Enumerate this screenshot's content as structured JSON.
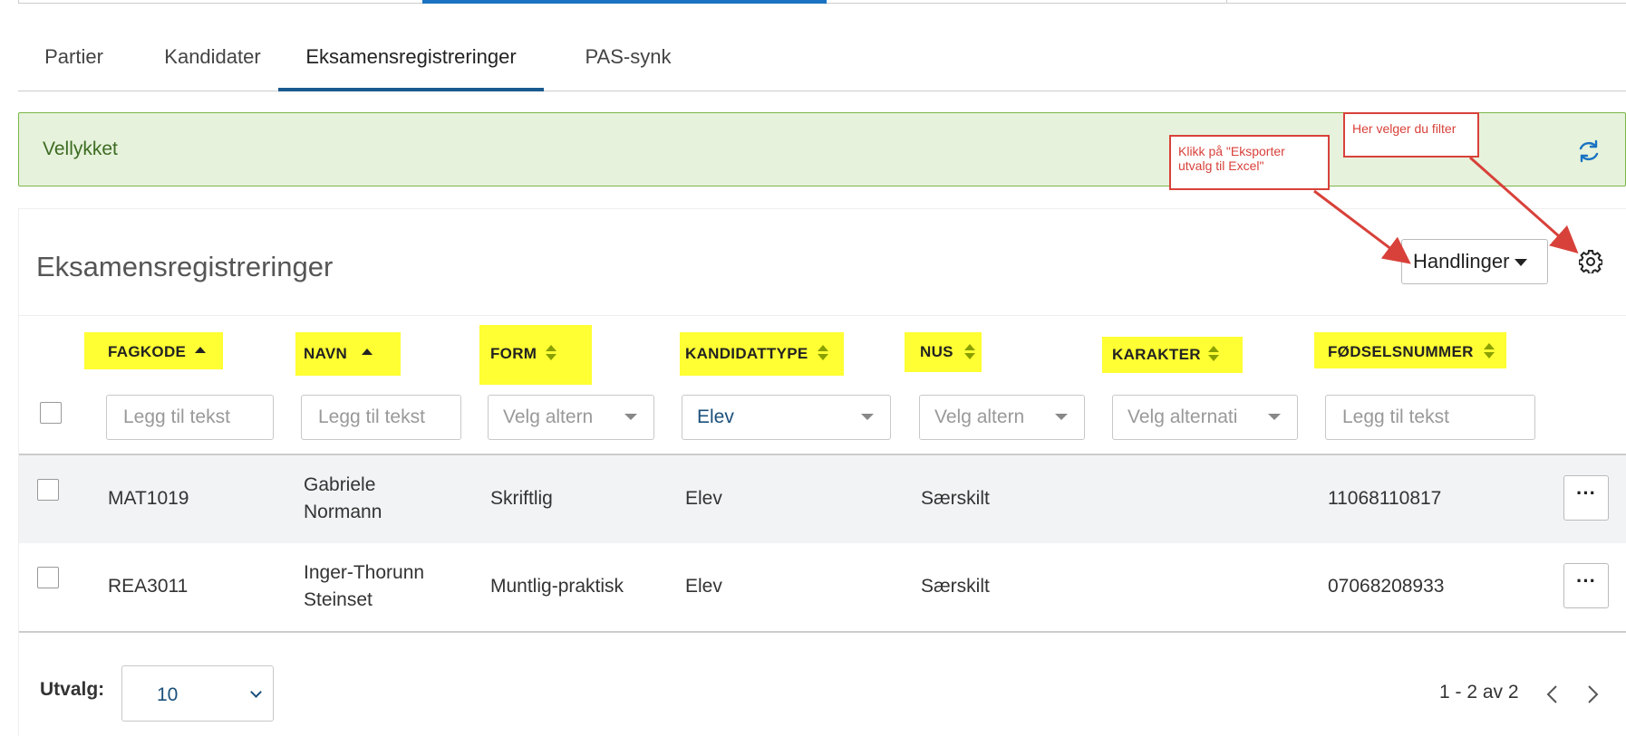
{
  "tabs": [
    {
      "label": "Partier"
    },
    {
      "label": "Kandidater"
    },
    {
      "label": "Eksamensregistreringer"
    },
    {
      "label": "PAS-synk"
    }
  ],
  "alert": {
    "message": "Vellykket",
    "icon": "refresh-icon"
  },
  "panel": {
    "title": "Eksamensregistreringer",
    "actions_label": "Handlinger",
    "settings_icon": "gear-icon"
  },
  "columns": [
    {
      "label": "FAGKODE",
      "sort": "ascending"
    },
    {
      "label": "NAVN",
      "sort": "ascending"
    },
    {
      "label": "FORM",
      "sort": "none"
    },
    {
      "label": "KANDIDATTYPE",
      "sort": "none"
    },
    {
      "label": "NUS",
      "sort": "none"
    },
    {
      "label": "KARAKTER",
      "sort": "none"
    },
    {
      "label": "FØDSELSNUMMER",
      "sort": "none"
    }
  ],
  "filters": {
    "fagkode_placeholder": "Legg til tekst",
    "navn_placeholder": "Legg til tekst",
    "form_value": "Velg altern",
    "kandidattype_value": "Elev",
    "nus_value": "Velg altern",
    "karakter_value": "Velg alternati",
    "fodselsnummer_placeholder": "Legg til tekst"
  },
  "rows": [
    {
      "fagkode": "MAT1019",
      "navn_1": "Gabriele",
      "navn_2": "Normann",
      "form": "Skriftlig",
      "kandidattype": "Elev",
      "nus": "Særskilt",
      "karakter": "",
      "fodselsnummer": "11068110817"
    },
    {
      "fagkode": "REA3011",
      "navn_1": "Inger-Thorunn",
      "navn_2": "Steinset",
      "form": "Muntlig-praktisk",
      "kandidattype": "Elev",
      "nus": "Særskilt",
      "karakter": "",
      "fodselsnummer": "07068208933"
    }
  ],
  "row_actions_label": "···",
  "footer": {
    "utvalg_label": "Utvalg:",
    "page_size": "10",
    "range_text": "1 - 2 av 2"
  },
  "annotations": {
    "filter_note": "Her velger du filter",
    "export_note_line1": "Klikk på \"Eksporter",
    "export_note_line2": "utvalg til Excel\""
  },
  "colors": {
    "accent": "#1a5a8f",
    "success_bg": "#e6f2db",
    "success_border": "#7ab648",
    "highlight": "#ffff33",
    "annotation": "#d8413a"
  }
}
